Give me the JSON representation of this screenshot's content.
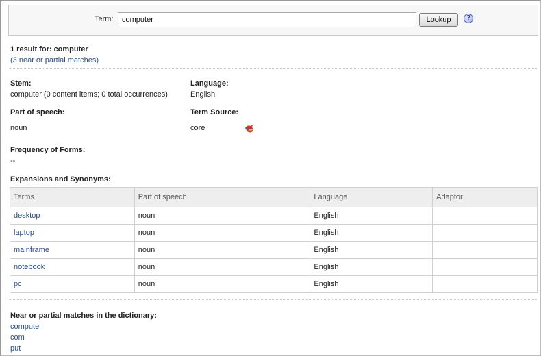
{
  "search": {
    "term_label": "Term:",
    "term_value": "computer",
    "lookup_label": "Lookup",
    "help_glyph": "?"
  },
  "result": {
    "summary": "1 result for: computer",
    "near_matches_link": "(3 near or partial matches)"
  },
  "details": {
    "stem_label": "Stem:",
    "stem_value": "computer (0 content items; 0 total occurrences)",
    "language_label": "Language:",
    "language_value": "English",
    "pos_label": "Part of speech:",
    "pos_value": "noun",
    "source_label": "Term Source:",
    "source_value": "core",
    "source_icon": "core-source-icon",
    "freq_label": "Frequency of Forms:",
    "freq_value": "--"
  },
  "expansions": {
    "heading": "Expansions and Synonyms:",
    "columns": [
      "Terms",
      "Part of speech",
      "Language",
      "Adaptor"
    ],
    "rows": [
      {
        "term": "desktop",
        "pos": "noun",
        "language": "English",
        "adaptor": ""
      },
      {
        "term": "laptop",
        "pos": "noun",
        "language": "English",
        "adaptor": ""
      },
      {
        "term": "mainframe",
        "pos": "noun",
        "language": "English",
        "adaptor": ""
      },
      {
        "term": "notebook",
        "pos": "noun",
        "language": "English",
        "adaptor": ""
      },
      {
        "term": "pc",
        "pos": "noun",
        "language": "English",
        "adaptor": ""
      }
    ]
  },
  "near": {
    "heading": "Near or partial matches in the dictionary:",
    "items": [
      "compute",
      "com",
      "put"
    ]
  },
  "colors": {
    "link": "#2a4f8f",
    "header_bg": "#eeeeee",
    "border": "#d0d0d0"
  }
}
